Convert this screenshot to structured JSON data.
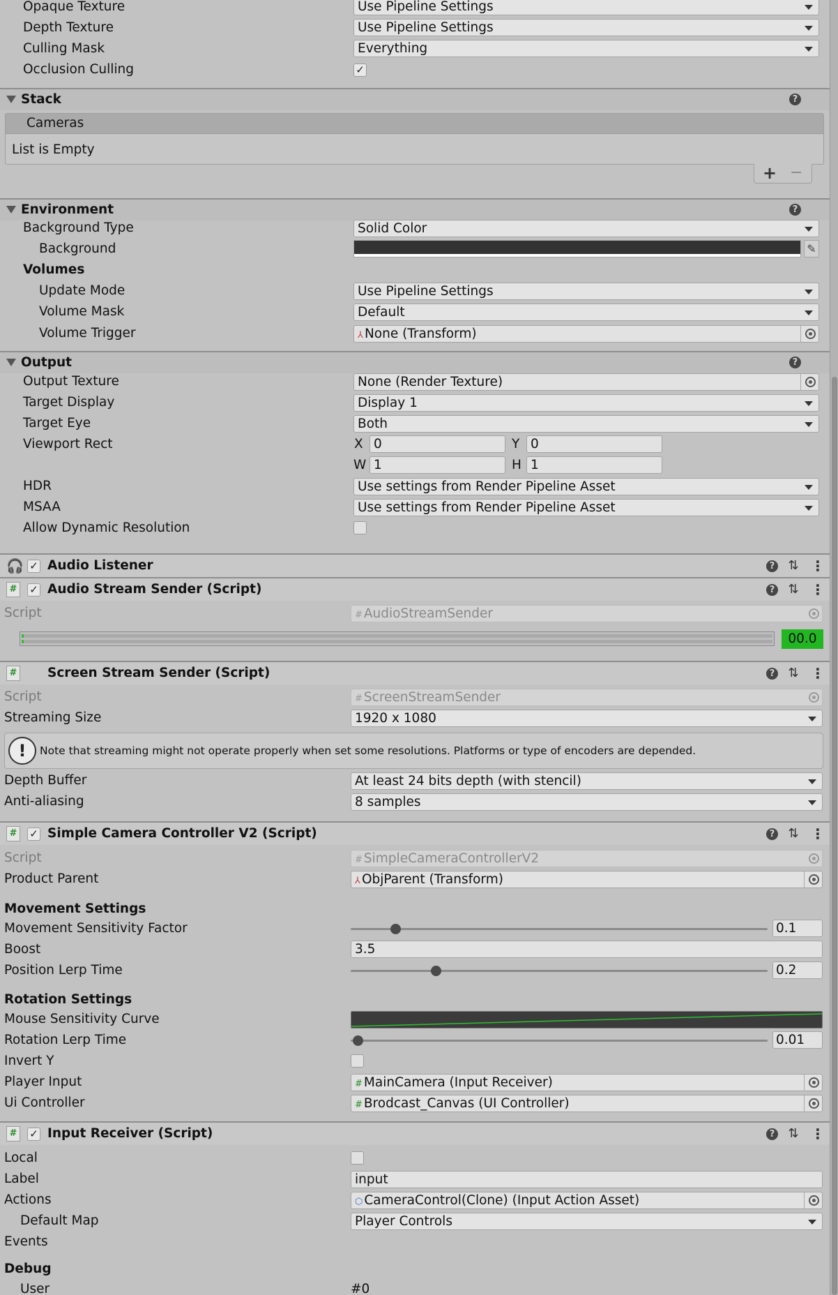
{
  "camera": {
    "rows": [
      {
        "label": "Opaque Texture",
        "value": "Use Pipeline Settings"
      },
      {
        "label": "Depth Texture",
        "value": "Use Pipeline Settings"
      },
      {
        "label": "Culling Mask",
        "value": "Everything"
      },
      {
        "label": "Occlusion Culling",
        "value": "✓"
      }
    ]
  },
  "stack": {
    "title": "Stack",
    "list_header": "Cameras",
    "empty_text": "List is Empty",
    "add": "+",
    "remove": "−"
  },
  "environment": {
    "title": "Environment",
    "background_type_label": "Background Type",
    "background_type_value": "Solid Color",
    "background_label": "Background",
    "background_color": "#333333",
    "volumes_label": "Volumes",
    "update_mode_label": "Update Mode",
    "update_mode_value": "Use Pipeline Settings",
    "volume_mask_label": "Volume Mask",
    "volume_mask_value": "Default",
    "volume_trigger_label": "Volume Trigger",
    "volume_trigger_value": "None (Transform)"
  },
  "output": {
    "title": "Output",
    "output_texture_label": "Output Texture",
    "output_texture_value": "None (Render Texture)",
    "target_display_label": "Target Display",
    "target_display_value": "Display 1",
    "target_eye_label": "Target Eye",
    "target_eye_value": "Both",
    "viewport_label": "Viewport Rect",
    "x_label": "X",
    "x_value": "0",
    "y_label": "Y",
    "y_value": "0",
    "w_label": "W",
    "w_value": "1",
    "h_label": "H",
    "h_value": "1",
    "hdr_label": "HDR",
    "hdr_value": "Use settings from Render Pipeline Asset",
    "msaa_label": "MSAA",
    "msaa_value": "Use settings from Render Pipeline Asset",
    "dynres_label": "Allow Dynamic Resolution"
  },
  "audio_listener": {
    "title": "Audio Listener"
  },
  "audio_stream": {
    "title": "Audio Stream Sender (Script)",
    "script_label": "Script",
    "script_value": "AudioStreamSender",
    "meter_value": "00.0",
    "meter_color": "#22b622"
  },
  "screen_stream": {
    "title": "Screen Stream Sender (Script)",
    "script_label": "Script",
    "script_value": "ScreenStreamSender",
    "size_label": "Streaming Size",
    "size_value": "1920 x 1080",
    "note": "Note that streaming might not operate properly when set some resolutions. Platforms or type of encoders are depended.",
    "depth_label": "Depth Buffer",
    "depth_value": "At least 24 bits depth (with stencil)",
    "aa_label": "Anti-aliasing",
    "aa_value": "8 samples"
  },
  "camera_controller": {
    "title": "Simple Camera Controller V2 (Script)",
    "script_label": "Script",
    "script_value": "SimpleCameraControllerV2",
    "parent_label": "Product Parent",
    "parent_value": "ObjParent (Transform)",
    "movement_header": "Movement Settings",
    "msf_label": "Movement Sensitivity Factor",
    "msf_value": "0.1",
    "boost_label": "Boost",
    "boost_value": "3.5",
    "plt_label": "Position Lerp Time",
    "plt_value": "0.2",
    "rotation_header": "Rotation Settings",
    "curve_label": "Mouse Sensitivity Curve",
    "curve_color": "#2fbf2f",
    "rlt_label": "Rotation Lerp Time",
    "rlt_value": "0.01",
    "inverty_label": "Invert Y",
    "player_input_label": "Player Input",
    "player_input_value": "MainCamera (Input Receiver)",
    "ui_controller_label": "Ui Controller",
    "ui_controller_value": "Brodcast_Canvas (UI Controller)"
  },
  "input_receiver": {
    "title": "Input Receiver (Script)",
    "local_label": "Local",
    "label_label": "Label",
    "label_value": "input",
    "actions_label": "Actions",
    "actions_value": "CameraControl(Clone) (Input Action Asset)",
    "default_map_label": "Default Map",
    "default_map_value": "Player Controls",
    "events_label": "Events",
    "debug_label": "Debug",
    "user_label": "User",
    "user_value": "#0"
  }
}
